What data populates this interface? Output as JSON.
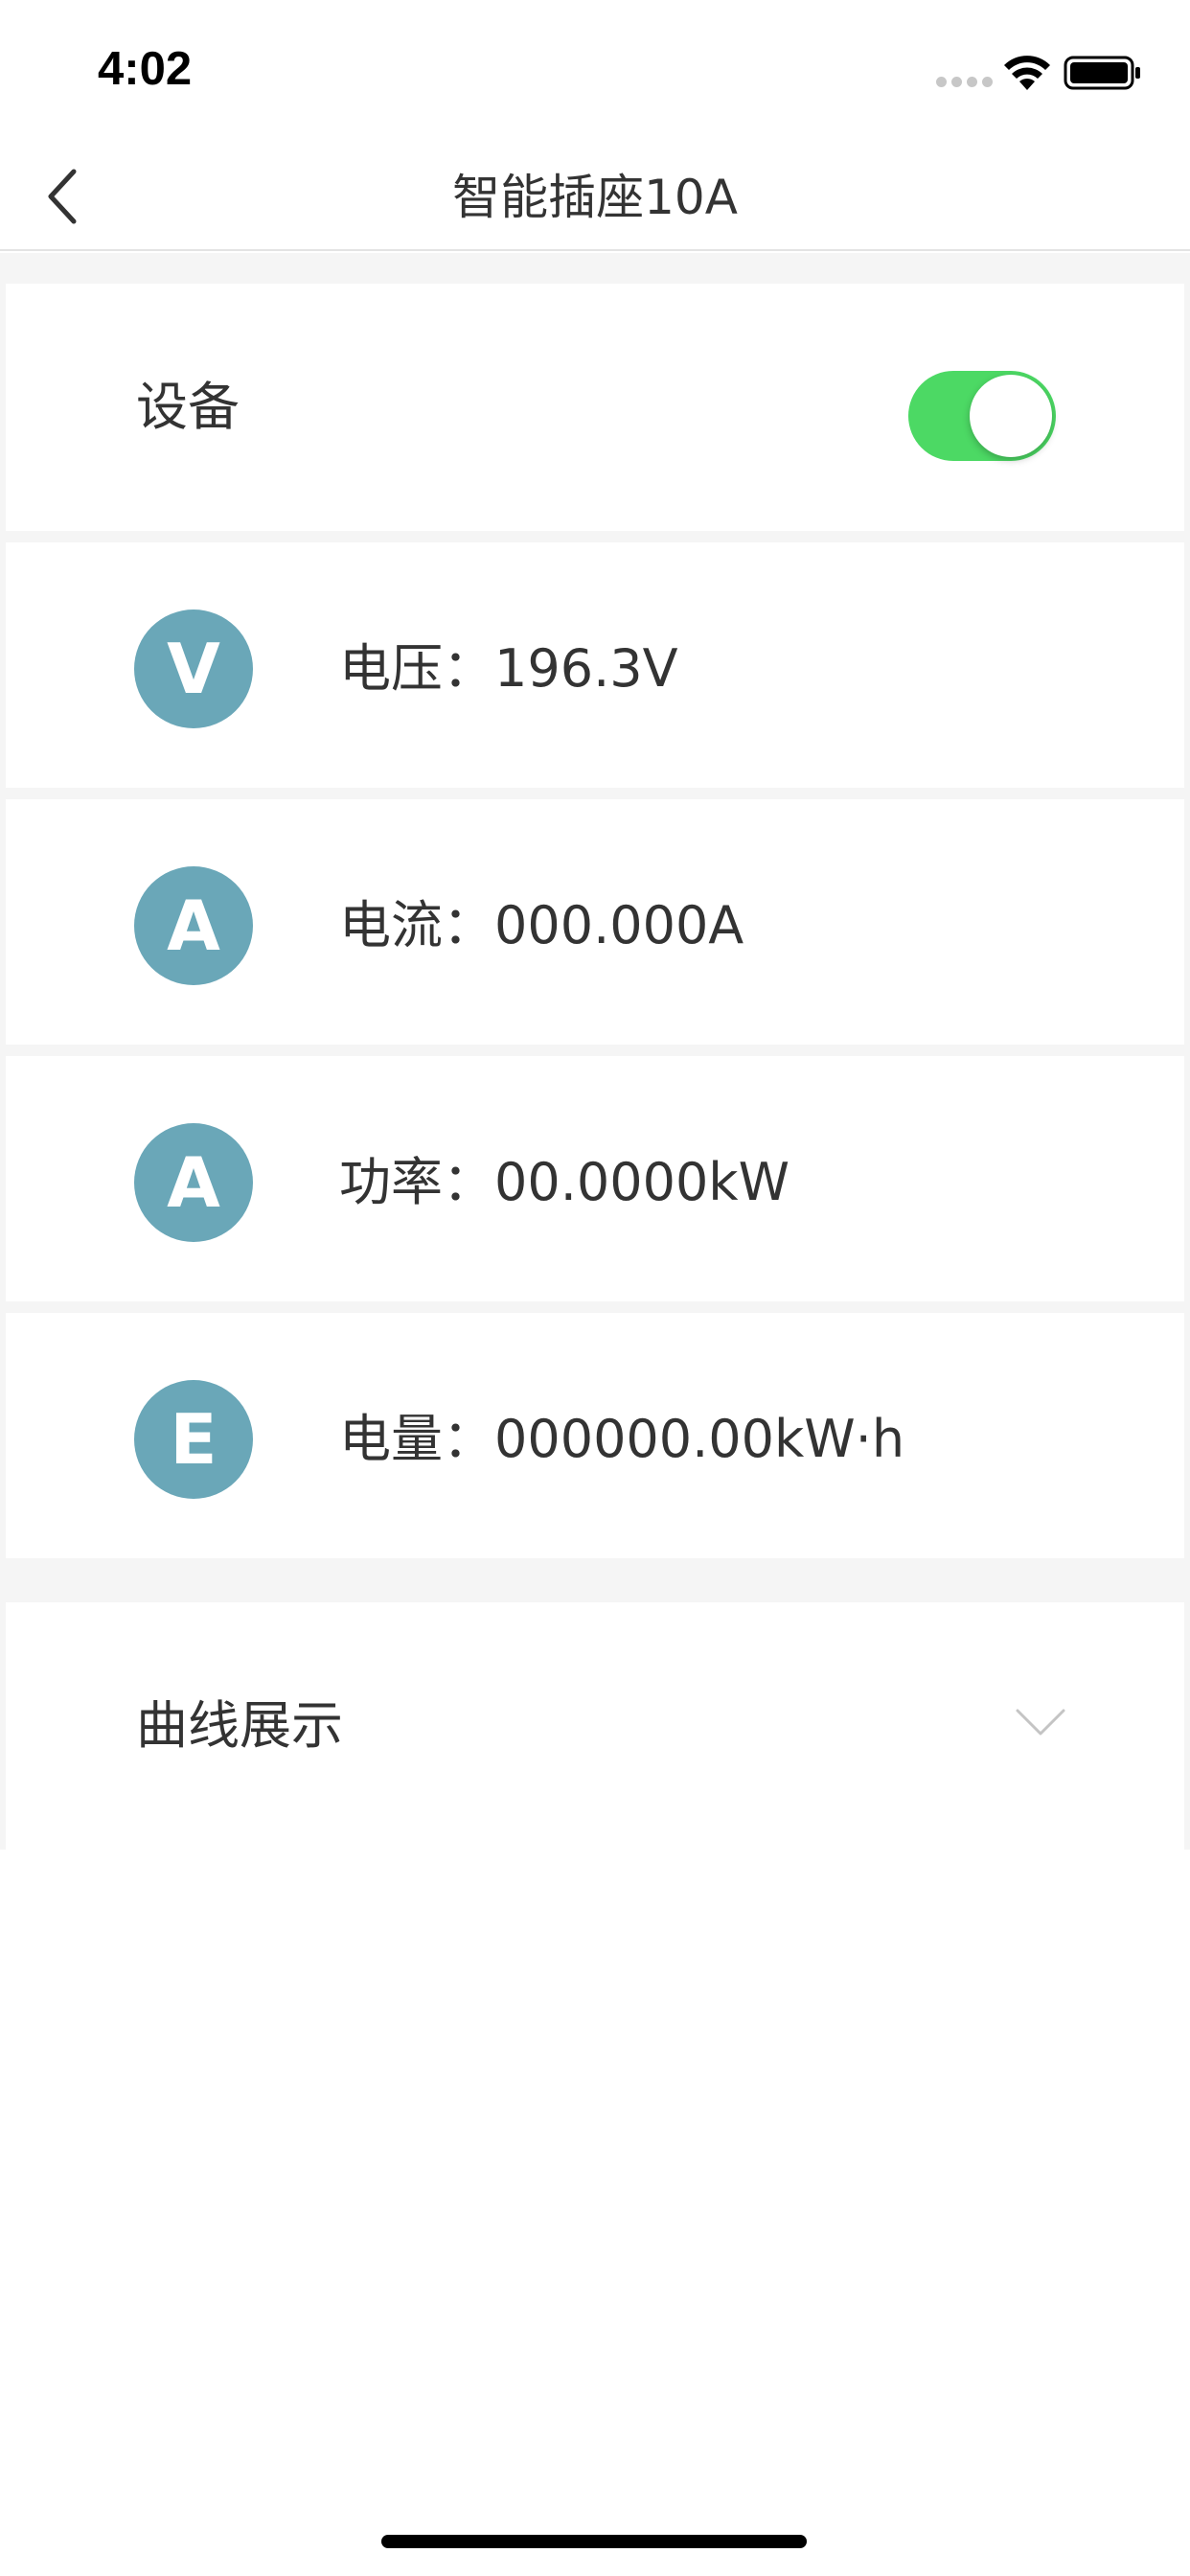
{
  "status_bar": {
    "time": "4:02"
  },
  "nav": {
    "title": "智能插座10A",
    "back_icon": "chevron-left-icon"
  },
  "device": {
    "label": "设备",
    "enabled": true,
    "toggle_color": "#4cd964"
  },
  "metrics": [
    {
      "icon_letter": "V",
      "label": "电压：",
      "value": "196.3V"
    },
    {
      "icon_letter": "A",
      "label": "电流：",
      "value": "000.000A"
    },
    {
      "icon_letter": "A",
      "label": "功率：",
      "value": "00.0000kW"
    },
    {
      "icon_letter": "E",
      "label": "电量：",
      "value": "000000.00kW·h"
    }
  ],
  "chart_section": {
    "label": "曲线展示",
    "icon": "chevron-down-icon"
  },
  "colors": {
    "icon_bg": "#6aa7b8",
    "text": "#333333",
    "background": "#f5f5f5"
  }
}
